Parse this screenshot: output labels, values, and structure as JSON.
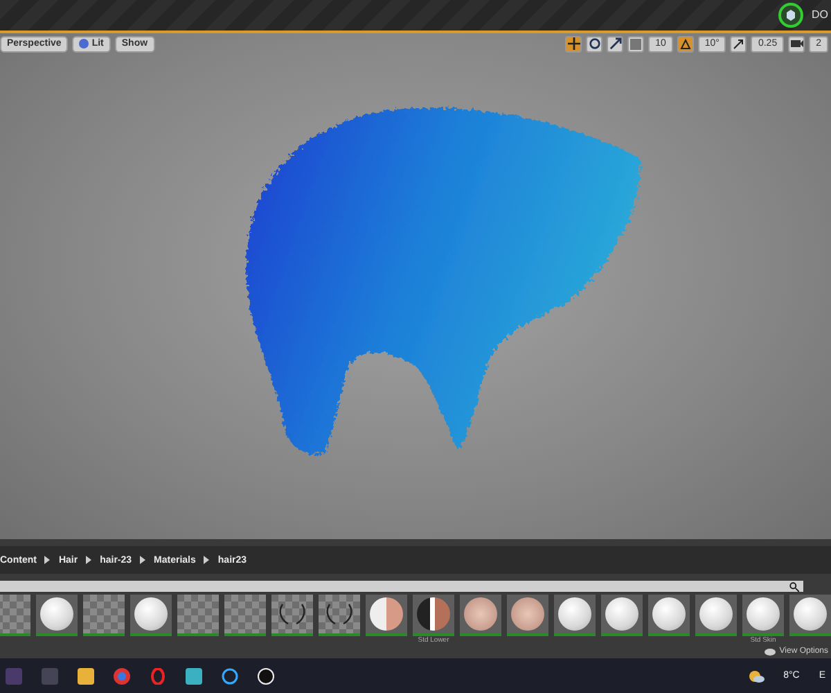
{
  "top_bar": {
    "label": "DO"
  },
  "viewport": {
    "view_buttons": [
      {
        "kind": "perspective",
        "label": "Perspective"
      },
      {
        "kind": "lit",
        "label": "Lit"
      },
      {
        "kind": "show",
        "label": "Show"
      }
    ],
    "transform_tools": [
      {
        "kind": "translate",
        "selected": true
      },
      {
        "kind": "rotate",
        "selected": false
      },
      {
        "kind": "scale",
        "selected": false
      }
    ],
    "snaps": [
      {
        "kind": "grid",
        "on": false,
        "value": "10"
      },
      {
        "kind": "angle",
        "on": true,
        "value": "10°"
      },
      {
        "kind": "scale",
        "on": false,
        "value": "0.25"
      },
      {
        "kind": "camera",
        "on": false,
        "value": "2"
      }
    ]
  },
  "content_browser": {
    "breadcrumb": [
      "Content",
      "Hair",
      "hair-23",
      "Materials",
      "hair23"
    ],
    "thumbnails": [
      {
        "kind": "checker"
      },
      {
        "kind": "sphere"
      },
      {
        "kind": "checker"
      },
      {
        "kind": "sphere"
      },
      {
        "kind": "checker"
      },
      {
        "kind": "checker"
      },
      {
        "kind": "strands"
      },
      {
        "kind": "strands"
      },
      {
        "kind": "skin"
      },
      {
        "kind": "dark",
        "label": "Std Lower"
      },
      {
        "kind": "face"
      },
      {
        "kind": "face"
      },
      {
        "kind": "sphere"
      },
      {
        "kind": "sphere"
      },
      {
        "kind": "sphere"
      },
      {
        "kind": "sphere"
      },
      {
        "kind": "sphere",
        "label": "Std Skin"
      },
      {
        "kind": "sphere"
      }
    ],
    "view_options": "View Options"
  },
  "taskbar": {
    "weather": "8°C",
    "language": "E"
  }
}
